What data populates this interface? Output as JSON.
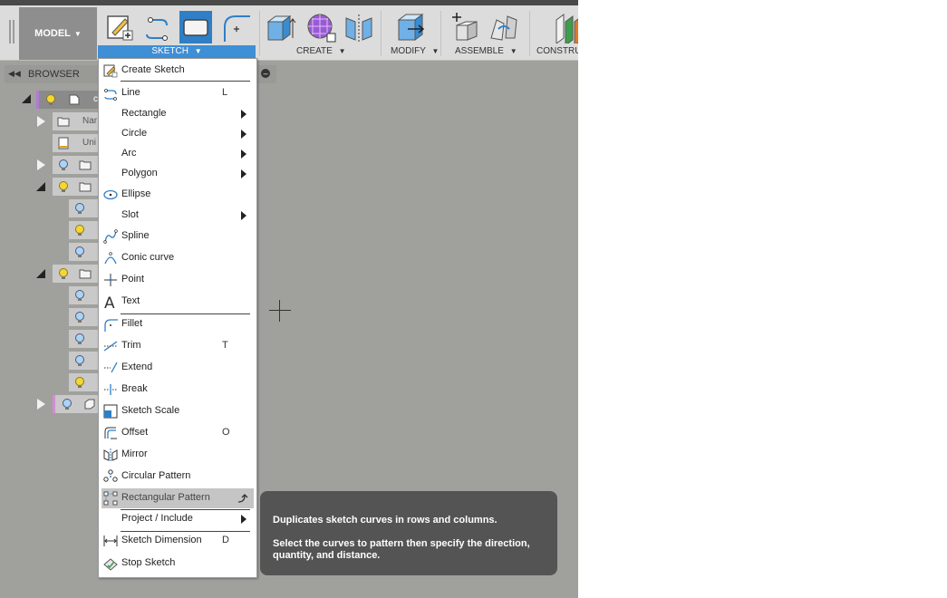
{
  "toolbar": {
    "workspace_label": "MODEL",
    "groups": {
      "sketch": "SKETCH",
      "create": "CREATE",
      "modify": "MODIFY",
      "assemble": "ASSEMBLE",
      "construct": "CONSTRU"
    }
  },
  "browser": {
    "title": "BROWSER",
    "rows": [
      {
        "text": "c"
      },
      {
        "text": "Nar"
      },
      {
        "text": "Uni"
      }
    ]
  },
  "sketch_menu": {
    "items": [
      {
        "label": "Create Sketch",
        "icon": "create-sketch-icon"
      },
      {
        "label": "Line",
        "shortcut": "L",
        "icon": "line-icon"
      },
      {
        "label": "Rectangle",
        "submenu": true
      },
      {
        "label": "Circle",
        "submenu": true
      },
      {
        "label": "Arc",
        "submenu": true
      },
      {
        "label": "Polygon",
        "submenu": true
      },
      {
        "label": "Ellipse",
        "icon": "ellipse-icon"
      },
      {
        "label": "Slot",
        "submenu": true
      },
      {
        "label": "Spline",
        "icon": "spline-icon"
      },
      {
        "label": "Conic curve",
        "icon": "conic-curve-icon"
      },
      {
        "label": "Point",
        "icon": "point-icon"
      },
      {
        "label": "Text",
        "icon": "text-icon"
      },
      {
        "label": "Fillet",
        "icon": "fillet-icon"
      },
      {
        "label": "Trim",
        "shortcut": "T",
        "icon": "trim-icon"
      },
      {
        "label": "Extend",
        "icon": "extend-icon"
      },
      {
        "label": "Break",
        "icon": "break-icon"
      },
      {
        "label": "Sketch Scale",
        "icon": "sketch-scale-icon"
      },
      {
        "label": "Offset",
        "shortcut": "O",
        "icon": "offset-icon"
      },
      {
        "label": "Mirror",
        "icon": "mirror-icon"
      },
      {
        "label": "Circular Pattern",
        "icon": "circular-pattern-icon"
      },
      {
        "label": "Rectangular Pattern",
        "icon": "rectangular-pattern-icon",
        "highlighted": true
      },
      {
        "label": "Project / Include",
        "submenu": true
      },
      {
        "label": "Sketch Dimension",
        "shortcut": "D",
        "icon": "sketch-dimension-icon"
      },
      {
        "label": "Stop Sketch",
        "icon": "stop-sketch-icon"
      }
    ]
  },
  "tooltip": {
    "line1": "Duplicates sketch curves in rows and columns.",
    "line2": "Select the curves to pattern then specify the direction, quantity, and distance."
  },
  "colors": {
    "accent": "#3e8fd6",
    "canvas": "#a0a09c",
    "tooltip_bg": "#545454",
    "bulb_on": "#f5d633",
    "bulb_off": "#aad4f5"
  }
}
